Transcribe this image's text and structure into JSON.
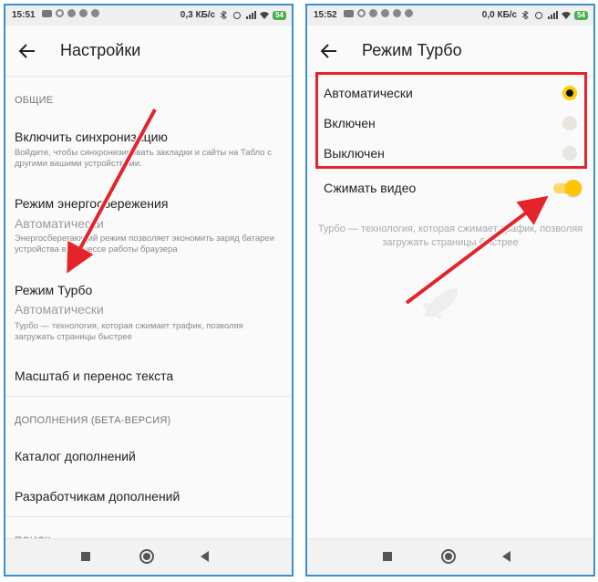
{
  "left_screen": {
    "status": {
      "time": "15:51",
      "speed": "0,3 КБ/с",
      "battery": "54"
    },
    "title": "Настройки",
    "section_general": "ОБЩИЕ",
    "items": [
      {
        "title": "Включить синхронизацию",
        "desc": "Войдите, чтобы синхронизировать закладки и сайты на Табло с другими вашими устройствами."
      },
      {
        "title": "Режим энергосбережения",
        "value": "Автоматически",
        "desc": "Энергосберегающий режим позволяет экономить заряд батареи устройства в процессе работы браузера"
      },
      {
        "title": "Режим Турбо",
        "value": "Автоматически",
        "desc": "Турбо — технология, которая сжимает трафик, позволяя загружать страницы быстрее"
      },
      {
        "title": "Масштаб и перенос текста"
      }
    ],
    "section_addons": "ДОПОЛНЕНИЯ (БЕТА-ВЕРСИЯ)",
    "addons": [
      {
        "title": "Каталог дополнений"
      },
      {
        "title": "Разработчикам дополнений"
      }
    ],
    "section_search": "ПОИСК"
  },
  "right_screen": {
    "status": {
      "time": "15:52",
      "speed": "0,0 КБ/с",
      "battery": "54"
    },
    "title": "Режим Турбо",
    "options": [
      {
        "label": "Автоматически",
        "selected": true
      },
      {
        "label": "Включен",
        "selected": false
      },
      {
        "label": "Выключен",
        "selected": false
      }
    ],
    "compress_video": {
      "label": "Сжимать видео",
      "on": true
    },
    "note": "Турбо — технология, которая сжимает трафик, позволяя загружать страницы быстрее"
  },
  "colors": {
    "accent": "#ffcc00",
    "highlight": "#e4242a",
    "frame": "#3d8fd0",
    "arrow": "#e4242a"
  },
  "icons": [
    "back-arrow-icon",
    "nav-recent-icon",
    "nav-home-icon",
    "nav-back-icon",
    "rocket-icon",
    "wifi-icon",
    "signal-icon",
    "battery-icon",
    "bluetooth-icon",
    "alarm-icon"
  ]
}
